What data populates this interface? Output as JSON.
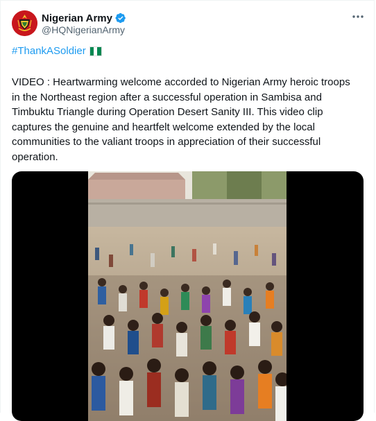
{
  "account": {
    "display_name": "Nigerian Army",
    "handle": "@HQNigerianArmy"
  },
  "tweet": {
    "hashtag": "#ThankASoldier",
    "text": "VIDEO : Heartwarming welcome accorded to Nigerian Army heroic troops in the Northeast region after a successful operation in Sambisa and Timbuktu Triangle during Operation Desert Sanity III. This video clip captures the genuine and heartfelt welcome extended by the local communities to the valiant troops in appreciation of their successful operation."
  },
  "icons": {
    "verified": "verified-badge-icon",
    "more": "more-options-icon",
    "flag": "nigeria-flag-icon"
  },
  "colors": {
    "link": "#1d9bf0",
    "verified": "#1d9bf0",
    "text": "#0f1419",
    "secondary_text": "#536471",
    "flag_green": "#008751"
  }
}
